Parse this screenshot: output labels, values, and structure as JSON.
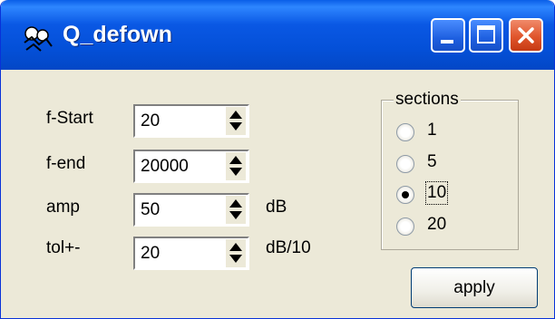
{
  "window": {
    "title": "Q_defown",
    "app_icon": "app-icon"
  },
  "fields": [
    {
      "label": "f-Start",
      "value": "20",
      "unit": ""
    },
    {
      "label": "f-end",
      "value": "20000",
      "unit": ""
    },
    {
      "label": "amp",
      "value": "50",
      "unit": "dB"
    },
    {
      "label": "tol+-",
      "value": "20",
      "unit": "dB/10"
    }
  ],
  "sections": {
    "title": "sections",
    "options": [
      "1",
      "5",
      "10",
      "20"
    ],
    "selected": "10"
  },
  "apply_label": "apply",
  "colors": {
    "titlebar": "#0a58e4",
    "window_bg": "#ece9d8",
    "close_button": "#e0552c"
  }
}
